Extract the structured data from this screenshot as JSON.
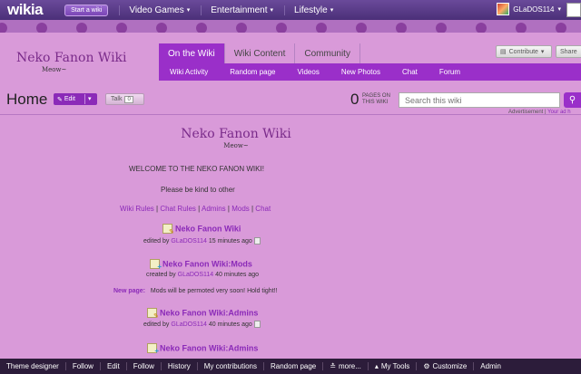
{
  "global_nav": {
    "logo": "wikia",
    "start_wiki": "Start a wiki",
    "items": [
      {
        "label": "Video Games"
      },
      {
        "label": "Entertainment"
      },
      {
        "label": "Lifestyle"
      }
    ],
    "username": "GLaDOS114"
  },
  "wiki_header": {
    "name": "Neko Fanon Wiki",
    "subtitle": "Meow~",
    "tabs": [
      {
        "label": "On the Wiki",
        "active": true
      },
      {
        "label": "Wiki Content",
        "active": false
      },
      {
        "label": "Community",
        "active": false
      }
    ],
    "subnav": [
      "Wiki Activity",
      "Random page",
      "Videos",
      "New Photos",
      "Chat",
      "Forum"
    ],
    "contribute": "Contribute",
    "share": "Share"
  },
  "page_header": {
    "title": "Home",
    "edit": "Edit",
    "talk": "Talk",
    "talk_count": "0",
    "page_count": "0",
    "page_count_label_1": "PAGES ON",
    "page_count_label_2": "THIS WIKI",
    "search_placeholder": "Search this wiki",
    "ad_link": "Advertisement",
    "ad_link_2": "Your ad h"
  },
  "content": {
    "title": "Neko Fanon Wiki",
    "subtitle": "Meow~",
    "welcome": "WELCOME TO THE NEKO FANON WIKI!",
    "kind": "Please be kind to other",
    "links": [
      "Wiki Rules",
      "Chat Rules",
      "Admins",
      "Mods",
      "Chat"
    ],
    "activity": [
      {
        "title": "Neko Fanon Wiki",
        "action": "edited by",
        "user": "GLaDOS114",
        "time": "15 minutes ago",
        "type": "edit"
      },
      {
        "title": "Neko Fanon Wiki:Mods",
        "action": "created by",
        "user": "GLaDOS114",
        "time": "40 minutes ago",
        "type": "new"
      },
      {
        "title": "Neko Fanon Wiki:Admins",
        "action": "edited by",
        "user": "GLaDOS114",
        "time": "40 minutes ago",
        "type": "edit"
      },
      {
        "title": "Neko Fanon Wiki:Admins",
        "type": "new"
      }
    ],
    "new_page_label": "New page:",
    "new_page_text": "Mods will be permoted very soon! Hold tight!!"
  },
  "toolbar": {
    "items": [
      "Theme designer",
      "Follow",
      "Edit",
      "Follow",
      "History",
      "My contributions",
      "Random page",
      "more...",
      "My Tools",
      "Customize",
      "Admin"
    ]
  }
}
